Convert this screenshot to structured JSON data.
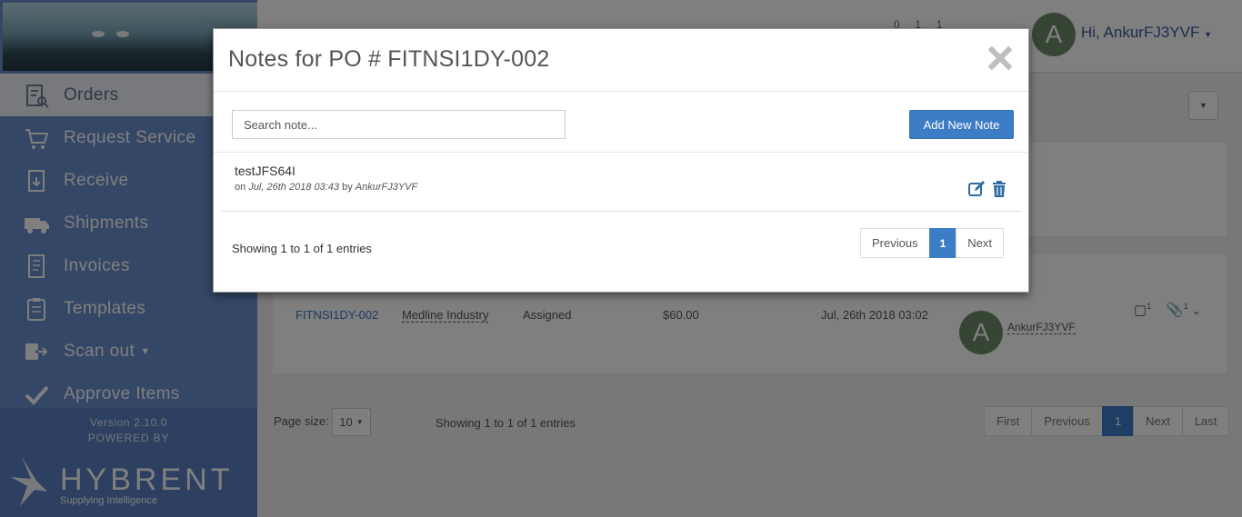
{
  "sidebar": {
    "nav_items": [
      {
        "label": "Orders",
        "icon": "orders-icon",
        "active": true
      },
      {
        "label": "Request Service",
        "icon": "request-service-icon"
      },
      {
        "label": "Receive",
        "icon": "receive-icon"
      },
      {
        "label": "Shipments",
        "icon": "truck-icon"
      },
      {
        "label": "Invoices",
        "icon": "invoice-icon"
      },
      {
        "label": "Templates",
        "icon": "templates-icon"
      },
      {
        "label": "Scan out",
        "icon": "scan-out-icon"
      },
      {
        "label": "Approve Items",
        "icon": "check-icon"
      }
    ],
    "version": "Version 2.10.0",
    "powered_by": "POWERED BY",
    "logo_text": "HYBRENT",
    "logo_tagline": "Supplying Intelligence"
  },
  "topbar": {
    "user_initial": "A",
    "greeting": "Hi, AnkurFJ3YVF",
    "badge_counts": [
      "0",
      "1",
      "1"
    ]
  },
  "orders_table": {
    "row": {
      "po": "FITNSI1DY-002",
      "vendor": "Medline Industry",
      "status": "Assigned",
      "amount": "$60.00",
      "date": "Jul, 26th 2018 03:02",
      "user_initial": "A",
      "user": "AnkurFJ3YVF",
      "note_count": "1",
      "attachment_count": "1"
    },
    "page_size_label": "Page size:",
    "page_size": "10",
    "showing": "Showing 1 to 1 of 1 entries",
    "pager": [
      "First",
      "Previous",
      "1",
      "Next",
      "Last"
    ]
  },
  "modal": {
    "title": "Notes for PO # FITNSI1DY-002",
    "search_placeholder": "Search note...",
    "add_button": "Add New Note",
    "notes": [
      {
        "text": "testJFS64I",
        "meta_prefix": "on",
        "date": "Jul, 26th 2018 03:43",
        "by": "by",
        "user": "AnkurFJ3YVF"
      }
    ],
    "showing": "Showing 1 to 1 of 1 entries",
    "pager": {
      "previous": "Previous",
      "current": "1",
      "next": "Next"
    }
  },
  "colors": {
    "sidebar": "#6b8fcc",
    "primary": "#3d7dc6",
    "avatar": "#6e8a6a"
  }
}
